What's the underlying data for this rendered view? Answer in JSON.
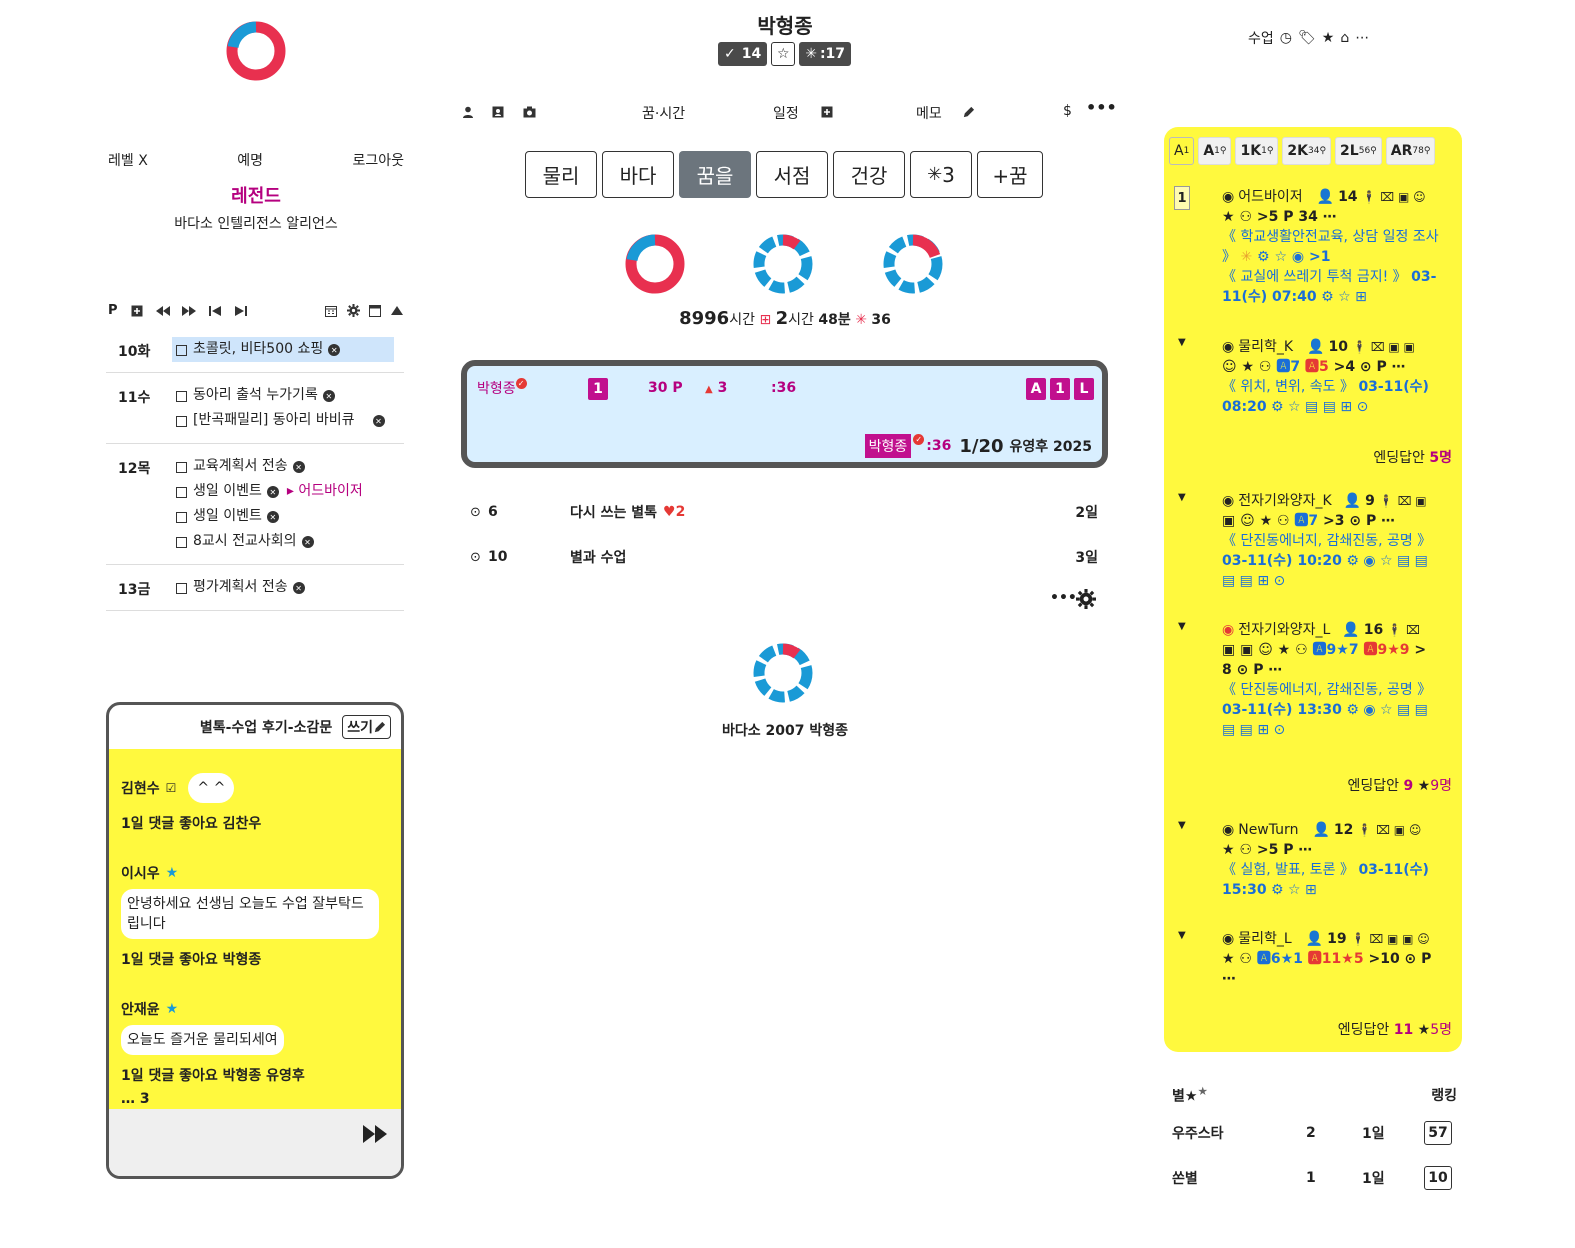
{
  "left": {
    "nav": {
      "level": "레벨 X",
      "nickname": "예명",
      "logout": "로그아웃"
    },
    "rank_title": "레전드",
    "alliance": "바다소 인텔리전스 알리언스",
    "planner_toolbar": {
      "label": "P"
    },
    "planner": [
      {
        "day": "10화",
        "tasks": [
          {
            "text": "초콜릿, 비타500 쇼핑",
            "highlight": true
          }
        ]
      },
      {
        "day": "11수",
        "tasks": [
          {
            "text": "동아리 출석 누가기록"
          },
          {
            "text": "[반곡패밀리] 동아리 바비큐"
          }
        ]
      },
      {
        "day": "12목",
        "tasks": [
          {
            "text": "교육계획서 전송"
          },
          {
            "text": "생일 이벤트",
            "link": "어드바이저"
          },
          {
            "text": "생일 이벤트"
          },
          {
            "text": "8교시 전교사회의"
          }
        ]
      },
      {
        "day": "13금",
        "tasks": [
          {
            "text": "평가계획서 전송"
          }
        ]
      }
    ]
  },
  "chat": {
    "title": "별톡-수업 후기-소감문",
    "write_label": "쓰기",
    "messages": [
      {
        "user": "김현수",
        "inline_bubble": "^ ^",
        "meta": "1일 댓글 좋아요 김찬우"
      },
      {
        "user": "이시우",
        "bubble": "안녕하세요 선생님 오늘도 수업 잘부탁드립니다",
        "meta": "1일 댓글 좋아요 박형종"
      },
      {
        "user": "안재윤",
        "bubble": "오늘도 즐거운 물리되세여",
        "meta": "1일 댓글 좋아요 박형종 유영후"
      }
    ],
    "more": "… 3"
  },
  "center": {
    "user": "박형종",
    "badges": {
      "check": "14",
      "spark": ":17"
    },
    "nav": {
      "dream_time": "꿈·시간",
      "schedule": "일정",
      "memo": "메모",
      "dollar": "$"
    },
    "buttons": [
      "물리",
      "바다",
      "꿈을",
      "서점",
      "건강",
      "3",
      "+꿈"
    ],
    "active_button": 2,
    "stats": {
      "hours": "8996",
      "hours_unit": "시간",
      "today_h": "2",
      "today_h_unit": "시간",
      "today_m": "48분",
      "spark_count": "36"
    },
    "card": {
      "name": "박형종",
      "level": "1",
      "points": "30 P",
      "up": "3",
      "time": ":36",
      "badges": [
        "A",
        "1",
        "L"
      ],
      "footer_name": "박형종",
      "footer_time": ":36",
      "footer_rank": "1/20",
      "footer_tail": "유영후 2025"
    },
    "list": [
      {
        "count": "6",
        "title": "다시 쓰는 별톡",
        "hearts": "2",
        "days": "2일"
      },
      {
        "count": "10",
        "title": "별과 수업",
        "days": "3일"
      }
    ],
    "footer_caption": "바다소 2007 박형종"
  },
  "right": {
    "nav": {
      "label": "수업"
    },
    "tabs": [
      {
        "label": "A",
        "sup": "1"
      },
      {
        "label": "A",
        "sup": "1"
      },
      {
        "label": "1K",
        "sup": "1"
      },
      {
        "label": "2K",
        "sup": "34"
      },
      {
        "label": "2L",
        "sup": "56"
      },
      {
        "label": "AR",
        "sup": "78"
      }
    ],
    "rank_badge": "1",
    "entries": [
      {
        "name": "어드바이저",
        "members": "14",
        "level": "5",
        "p": "P 34",
        "desc": "《 학교생활안전교육, 상담 일정 조사 》",
        "after": "1",
        "desc2": "《 교실에 쓰레기 투척 금지! 》",
        "date": "03-11(수) 07:40"
      },
      {
        "name": "물리학_K",
        "members": "10",
        "a": "7",
        "b": "5",
        "level": "4",
        "p": "P",
        "desc": "《 위치, 변위, 속도 》",
        "date": "03-11(수)",
        "time": "08:20",
        "ending_label": "엔딩답안",
        "ending_count": "5명"
      },
      {
        "name": "전자기와양자_K",
        "members": "9",
        "a": "7",
        "level": "3",
        "p": "P",
        "desc": "《 단진동에너지, 감쇄진동, 공명 》",
        "date": "03-11(수) 10:20"
      },
      {
        "name": "전자기와양자_L",
        "members": "16",
        "a": "9",
        "a_star": "7",
        "b": "9",
        "b_star": "9",
        "level": "8",
        "p": "P",
        "desc": "《 단진동에너지, 감쇄진동, 공명 》",
        "date": "03-11(수) 13:30",
        "ending_label": "엔딩답안",
        "ending_count": "9",
        "ending_star": "9명"
      },
      {
        "name": "NewTurn",
        "members": "12",
        "level": "5",
        "p": "P",
        "desc": "《 실험, 발표, 토론 》",
        "date": "03-11(수)",
        "time": "15:30"
      },
      {
        "name": "물리학_L",
        "members": "19",
        "a": "6",
        "a_star": "1",
        "b": "11",
        "b_star": "5",
        "level": "10",
        "p": "P",
        "ending_label": "엔딩답안",
        "ending_count": "11",
        "ending_star": "5명"
      }
    ],
    "rank_table": {
      "header_left": "별",
      "header_right": "랭킹",
      "rows": [
        {
          "name": "우주스타",
          "count": "2",
          "days": "1일",
          "rank": "57"
        },
        {
          "name": "쏜별",
          "count": "1",
          "days": "1일",
          "rank": "10"
        }
      ]
    }
  },
  "colors": {
    "accent": "#c1108e",
    "yellow": "#fff93e",
    "blue": "#1a9ad6",
    "red": "#e8304f",
    "card_bg": "#d9efff"
  }
}
